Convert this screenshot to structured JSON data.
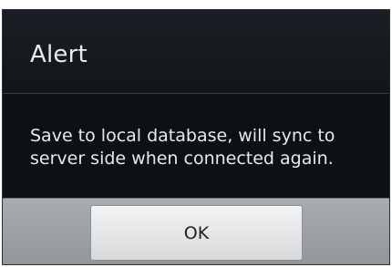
{
  "dialog": {
    "title": "Alert",
    "message": "Save to local database, will sync to server side when connected again.",
    "ok_label": "OK"
  }
}
